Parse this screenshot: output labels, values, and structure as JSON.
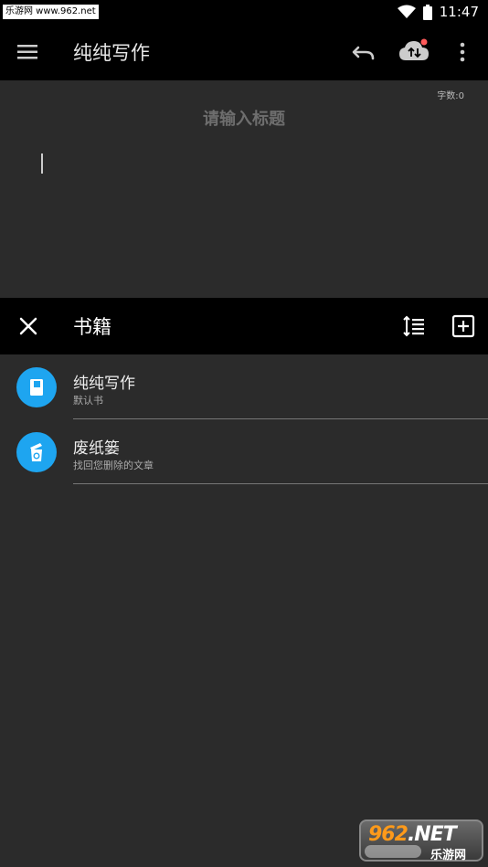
{
  "status_bar": {
    "watermark_text": "乐游网 www.962.net",
    "time": "11:47"
  },
  "app_bar": {
    "title": "纯纯写作",
    "icons": [
      "menu-icon",
      "undo-icon",
      "cloud-sync-icon",
      "more-vert-icon"
    ]
  },
  "editor": {
    "word_count": "字数:0",
    "title_placeholder": "请输入标题"
  },
  "books_panel": {
    "title": "书籍",
    "icons": [
      "close-icon",
      "sort-icon",
      "add-box-icon"
    ],
    "items": [
      {
        "name": "纯纯写作",
        "subtitle": "默认书",
        "icon": "book-icon"
      },
      {
        "name": "废纸篓",
        "subtitle": "找回您删除的文章",
        "icon": "trash-icon"
      }
    ]
  },
  "colors": {
    "accent": "#1ea5f0",
    "bar_background": "#000000",
    "surface": "#2b2b2b",
    "notification_dot": "#ff5a5a"
  },
  "corner_watermark": {
    "number_prefix": "962",
    "suffix": ".NET",
    "label": "乐游网"
  }
}
